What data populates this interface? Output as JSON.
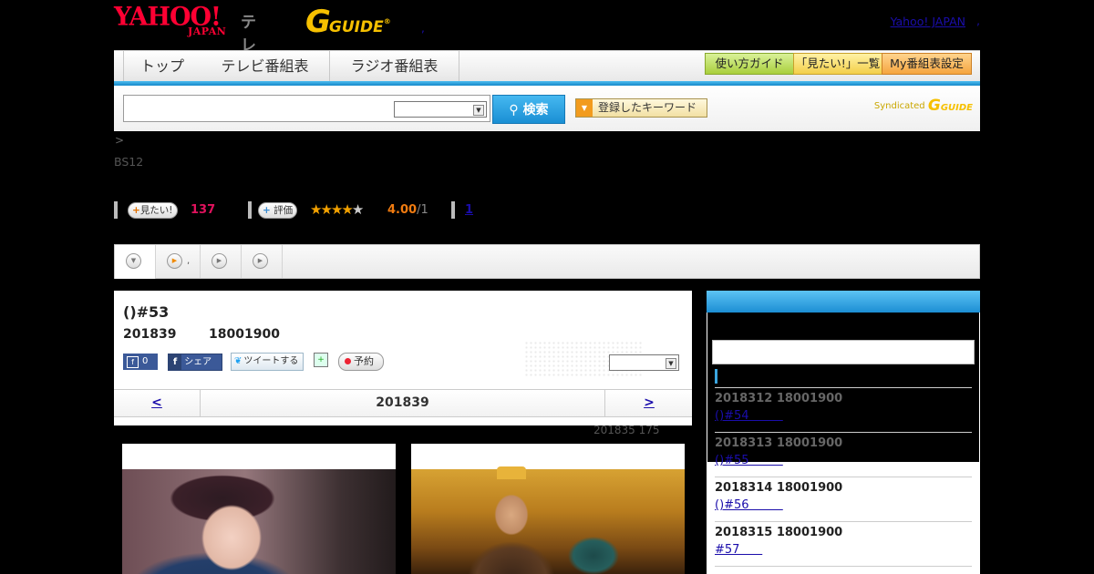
{
  "header": {
    "logo_yahoo": "YAHOO!",
    "logo_japan": "JAPAN",
    "logo_tv": "テレビ",
    "logo_gguide": "GUIDE",
    "logo_reg": "®",
    "dot": ",",
    "yahoo_japan_link": "Yahoo! JAPAN",
    "yahoo_japan_tail": ","
  },
  "nav": {
    "tabs": [
      "トップ",
      "テレビ番組表",
      "ラジオ番組表"
    ],
    "buttons": [
      "使い方ガイド",
      "「見たい!」一覧",
      "My番組表設定"
    ]
  },
  "search": {
    "input_value": "",
    "select_value": "",
    "button_label": "検索",
    "keyword_button": "登録したキーワード",
    "syndicated": "Syndicated",
    "syndicated_logo": "GUIDE"
  },
  "program_head": {
    "breadcrumb": ">",
    "channel": "BS12",
    "want_label": "見たい!",
    "want_count": "137",
    "rate_label": "評価",
    "stars_filled": 4,
    "stars_total": 5,
    "score": "4.00",
    "score_sub": "/1",
    "review_link": "1"
  },
  "tabs_strip": {
    "tab2_dot": ","
  },
  "program": {
    "title": "()#53",
    "date": "201839",
    "time": "18001900",
    "fb_like_count": "0",
    "fb_share_label": "シェア",
    "tweet_label": "ツイートする",
    "reserve_label": "予約",
    "select_value": ""
  },
  "day_nav": {
    "prev": "<",
    "date": "201839",
    "next": ">"
  },
  "update_note": "201835  175",
  "sidebar": {
    "items": [
      {
        "datetime": "2018312  18001900",
        "link": "()#54         ",
        "dt_color": "#666"
      },
      {
        "datetime": "2018313  18001900",
        "link": "()#55         ",
        "dt_color": "#666"
      },
      {
        "datetime": "2018314  18001900",
        "link": "()#56         ",
        "dt_color": "#222"
      },
      {
        "datetime": "2018315  18001900",
        "link": "#57      ",
        "dt_color": "#222"
      }
    ]
  }
}
